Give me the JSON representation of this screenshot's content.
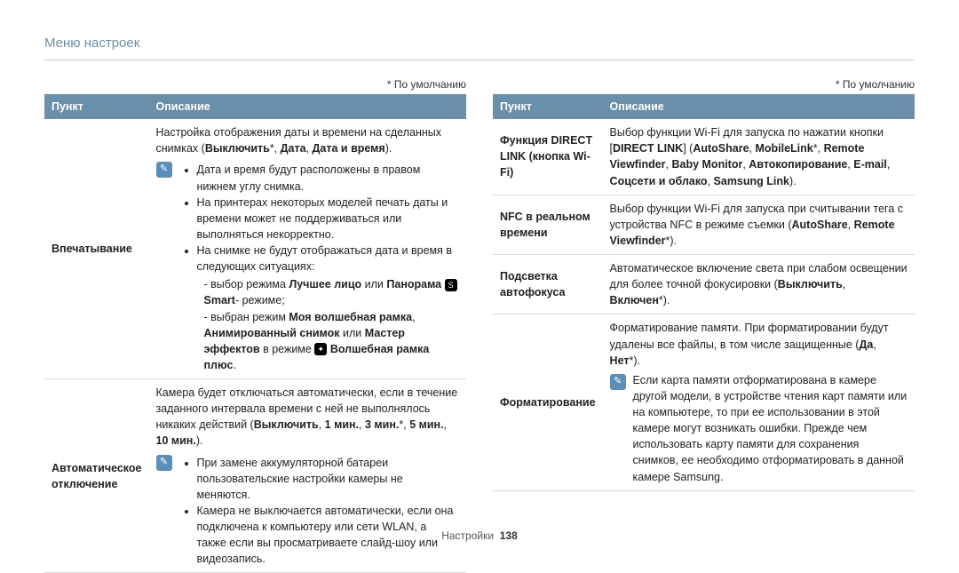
{
  "breadcrumb": "Меню настроек",
  "default_note": "* По умолчанию",
  "headers": {
    "item": "Пункт",
    "desc": "Описание"
  },
  "left": [
    {
      "label": "Впечатывание",
      "intro_html": "Настройка отображения даты и времени на сделанных снимках (<b>Выключить</b>*, <b>Дата</b>, <b>Дата и время</b>).",
      "note_bullets_html": [
        "Дата и время будут расположены в правом нижнем углу снимка.",
        "На принтерах некоторых моделей печать даты и времени может не поддерживаться или выполняться некорректно.",
        "На снимке не будут отображаться дата и время в следующих ситуациях:"
      ],
      "note_sub_html": [
        "выбор режима <b>Лучшее лицо</b> или <b>Панорама</b> <span class='mode-icon'>S</span> <b>Smart</b>- режиме;",
        "выбран режим <b>Моя волшебная рамка</b>, <b>Анимированный снимок</b> или <b>Мастер эффектов</b> в режиме <span class='mode-icon'>✦</span> <b>Волшебная рамка плюс</b>."
      ]
    },
    {
      "label": "Автоматическое отключение",
      "intro_html": "Камера будет отключаться автоматически, если в течение заданного интервала времени с ней не выполнялось никаких действий (<b>Выключить</b>, <b>1 мин.</b>, <b>3 мин.</b>*, <b>5 мин.</b>, <b>10 мин.</b>).",
      "note_bullets_html": [
        "При замене аккумуляторной батареи пользовательские настройки камеры не меняются.",
        "Камера не выключается автоматически, если она подключена к компьютеру или сети WLAN, а также если вы просматриваете слайд-шоу или видеозапись."
      ]
    }
  ],
  "right": [
    {
      "label": "Функция DIRECT LINK (кнопка Wi-Fi)",
      "desc_html": "Выбор функции Wi-Fi для запуска по нажатии кнопки [<b>DIRECT LINK</b>] (<b>AutoShare</b>, <b>MobileLink</b>*, <b>Remote Viewfinder</b>, <b>Baby Monitor</b>, <b>Автокопирование</b>, <b>E-mail</b>, <b>Соцсети и облако</b>, <b>Samsung Link</b>)."
    },
    {
      "label": "NFC в реальном времени",
      "desc_html": "Выбор функции Wi-Fi для запуска при считывании тега с устройства NFC в режиме съемки (<b>AutoShare</b>, <b>Remote Viewfinder</b>*)."
    },
    {
      "label": "Подсветка автофокуса",
      "desc_html": "Автоматическое включение света при слабом освещении для более точной фокусировки (<b>Выключить</b>, <b>Включен</b>*)."
    },
    {
      "label": "Форматирование",
      "intro_html": "Форматирование памяти. При форматировании будут удалены все файлы, в том числе защищенные (<b>Да</b>, <b>Нет</b>*).",
      "note_html": "Если карта памяти отформатирована в камере другой модели, в устройстве чтения карт памяти или на компьютере, то при ее использовании в этой камере могут возникать ошибки. Прежде чем использовать карту памяти для сохранения снимков, ее необходимо отформатировать в данной камере Samsung."
    }
  ],
  "footer": {
    "section": "Настройки",
    "page": "138"
  }
}
